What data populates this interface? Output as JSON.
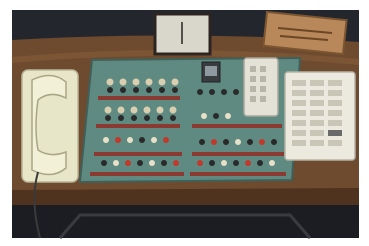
{
  "photo": {
    "colors": {
      "frame": "#ffffff",
      "wall": "#24262e",
      "desk": "#6e4a2e",
      "panel": "#5f8a82",
      "handset": "#e8e6c8",
      "keypad": "#eceadf",
      "plaque": "#b8875a"
    }
  }
}
